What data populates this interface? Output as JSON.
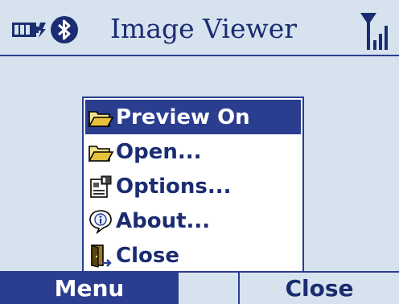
{
  "app": {
    "title": "Image Viewer"
  },
  "status": {
    "battery_icon": "battery-charging-icon",
    "bluetooth_icon": "bluetooth-icon",
    "signal_icon": "signal-strength-icon"
  },
  "menu": {
    "items": [
      {
        "label": "Preview On",
        "icon": "open-folder-icon",
        "selected": true
      },
      {
        "label": "Open...",
        "icon": "open-folder-icon",
        "selected": false
      },
      {
        "label": "Options...",
        "icon": "options-icon",
        "selected": false
      },
      {
        "label": "About...",
        "icon": "info-icon",
        "selected": false
      },
      {
        "label": "Close",
        "icon": "exit-door-icon",
        "selected": false
      }
    ]
  },
  "softkeys": {
    "left": "Menu",
    "right": "Close"
  },
  "colors": {
    "accent": "#2a3d8f",
    "background": "#d6e3ee",
    "text": "#1b2c72"
  }
}
